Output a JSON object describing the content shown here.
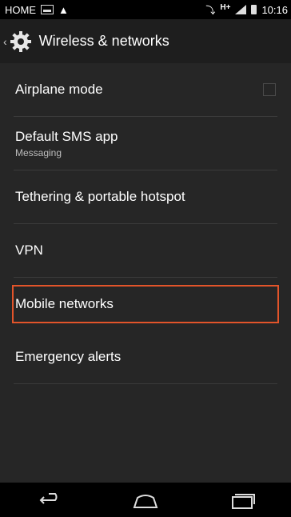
{
  "status_bar": {
    "carrier": "HOME",
    "network": "H+",
    "time": "10:16"
  },
  "action_bar": {
    "title": "Wireless & networks",
    "icon": "gear-icon"
  },
  "items": [
    {
      "title": "Airplane mode",
      "summary": "",
      "has_checkbox": true,
      "checked": false
    },
    {
      "title": "Default SMS app",
      "summary": "Messaging"
    },
    {
      "title": "Tethering & portable hotspot",
      "summary": ""
    },
    {
      "title": "VPN",
      "summary": ""
    },
    {
      "title": "Mobile networks",
      "summary": "",
      "highlighted": true
    },
    {
      "title": "Emergency alerts",
      "summary": ""
    }
  ],
  "nav_bar": {
    "icons": [
      "back-icon",
      "home-icon",
      "recent-apps-icon"
    ]
  },
  "colors": {
    "background": "#262626",
    "highlight": "#e2542a"
  }
}
